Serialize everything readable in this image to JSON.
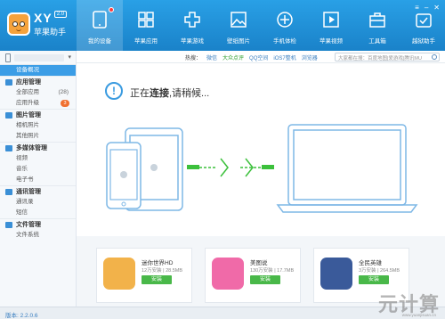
{
  "header": {
    "brand": {
      "name": "XY",
      "version_badge": "2.0",
      "subtitle": "苹果助手"
    },
    "nav": [
      {
        "label": "我的设备",
        "icon": "tablet-icon",
        "active": true,
        "has_dot": true
      },
      {
        "label": "苹果应用",
        "icon": "grid-apps-icon",
        "active": false
      },
      {
        "label": "苹果游戏",
        "icon": "gamepad-icon",
        "active": false
      },
      {
        "label": "壁纸图片",
        "icon": "image-icon",
        "active": false
      },
      {
        "label": "手机体检",
        "icon": "checkup-icon",
        "active": false
      },
      {
        "label": "苹果视频",
        "icon": "video-icon",
        "active": false
      },
      {
        "label": "工具箱",
        "icon": "toolbox-icon",
        "active": false
      },
      {
        "label": "越狱助手",
        "icon": "jailbreak-icon",
        "active": false
      }
    ]
  },
  "sidebar": {
    "device_overview": "设备概况",
    "groups": [
      {
        "title": "应用管理",
        "items": [
          {
            "label": "全部应用",
            "count": "(28)"
          },
          {
            "label": "应用升级",
            "badge": "3"
          }
        ]
      },
      {
        "title": "图片管理",
        "items": [
          {
            "label": "相机照片"
          },
          {
            "label": "其他照片"
          }
        ]
      },
      {
        "title": "多媒体管理",
        "items": [
          {
            "label": "视频"
          },
          {
            "label": "音乐"
          },
          {
            "label": "电子书"
          }
        ]
      },
      {
        "title": "通讯管理",
        "items": [
          {
            "label": "通讯录"
          },
          {
            "label": "短信"
          }
        ]
      },
      {
        "title": "文件管理",
        "items": [
          {
            "label": "文件系统"
          }
        ]
      }
    ]
  },
  "topbar": {
    "hot_label": "热搜：",
    "hot_links": [
      "微信",
      "大众点评",
      "QQ空间",
      "iOS7整机",
      "浏览器"
    ],
    "search_placeholder": "大家都在搜：百度地图|爱游戏|腾讯MU"
  },
  "connection": {
    "icon_text": "!",
    "message_prefix": "正在",
    "message_bold": "连接",
    "message_suffix": ",请稍候..."
  },
  "apps": [
    {
      "name": "迷你世界HD",
      "size": "12万安装 | 28.5MB",
      "install": "安装",
      "color": "#f2b24a"
    },
    {
      "name": "美图说",
      "size": "130万安装 | 17.7MB",
      "install": "安装",
      "color": "#f06aa8"
    },
    {
      "name": "全民英雄",
      "size": "3万安装 | 264.5MB",
      "install": "安装",
      "color": "#3a5a9a"
    }
  ],
  "status": {
    "version": "版本: 2.2.0.6"
  },
  "watermark": {
    "big": "元计算",
    "small": "www.yuanjisuan.cn"
  },
  "colors": {
    "header": "#1a8ad8",
    "accent": "#3a9be0",
    "install": "#49b849",
    "connector": "#3cc03c"
  }
}
